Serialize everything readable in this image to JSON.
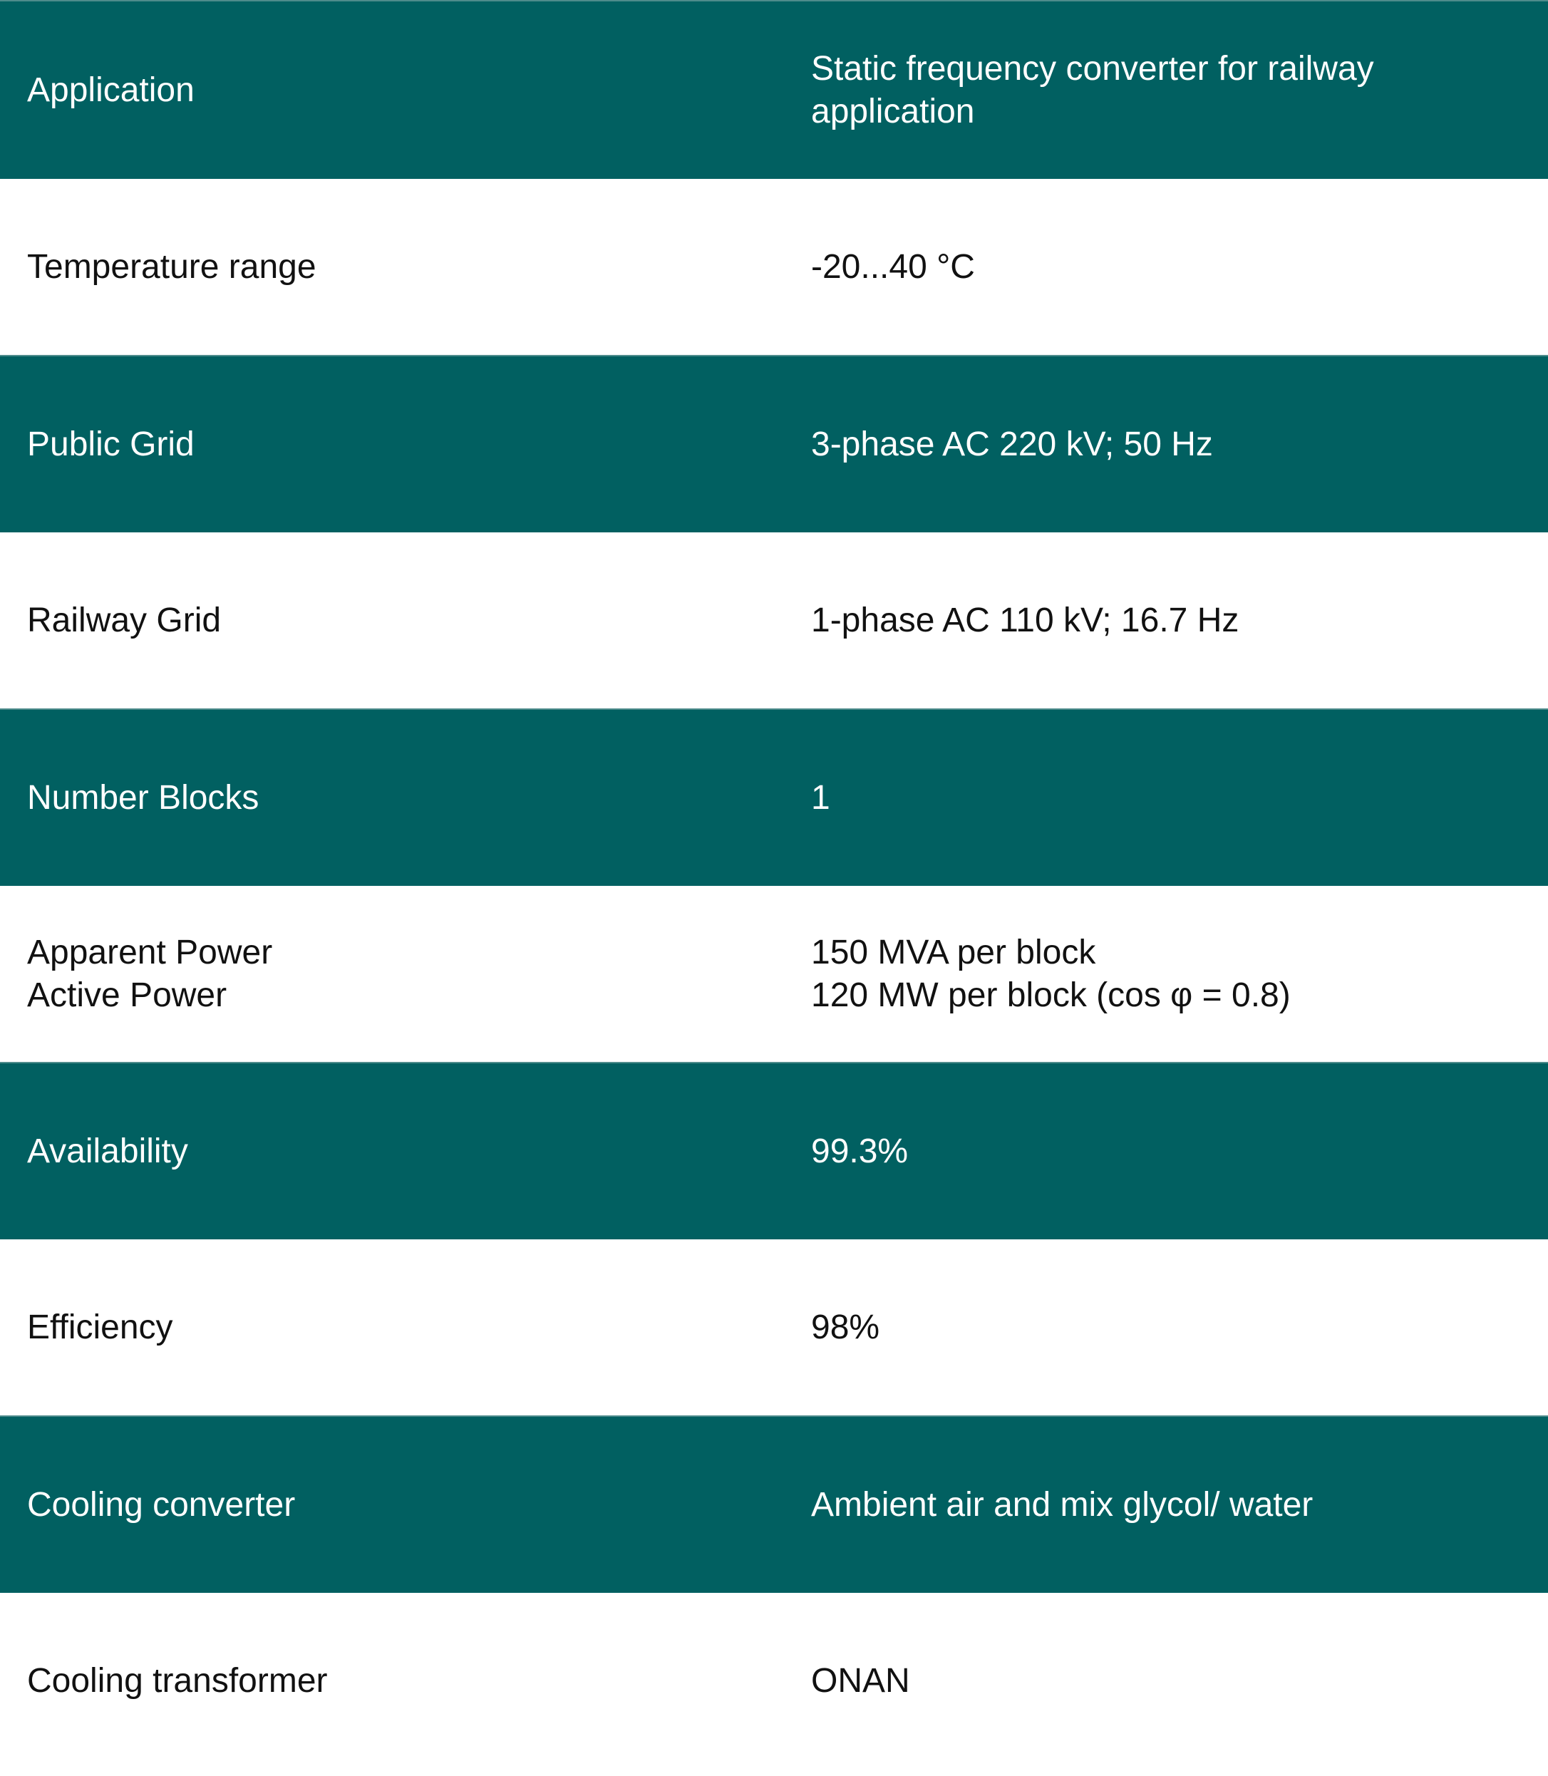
{
  "colors": {
    "row_dark": "#016061",
    "row_light": "#ffffff",
    "text_on_dark": "#ffffff",
    "text_on_light": "#111111"
  },
  "rows": [
    {
      "label": [
        "Application"
      ],
      "value": [
        "Static frequency converter for railway application"
      ]
    },
    {
      "label": [
        "Temperature range"
      ],
      "value": [
        "-20...40 °C"
      ]
    },
    {
      "label": [
        "Public Grid"
      ],
      "value": [
        "3-phase AC 220 kV; 50 Hz"
      ]
    },
    {
      "label": [
        "Railway Grid"
      ],
      "value": [
        "1-phase AC 110 kV; 16.7 Hz"
      ]
    },
    {
      "label": [
        "Number Blocks"
      ],
      "value": [
        "1"
      ]
    },
    {
      "label": [
        "Apparent Power",
        "Active Power"
      ],
      "value": [
        "150 MVA per block",
        "120 MW per block (cos φ = 0.8)"
      ]
    },
    {
      "label": [
        "Availability"
      ],
      "value": [
        "99.3%"
      ]
    },
    {
      "label": [
        "Efficiency"
      ],
      "value": [
        "98%"
      ]
    },
    {
      "label": [
        "Cooling converter"
      ],
      "value": [
        "Ambient air and mix glycol/ water"
      ]
    },
    {
      "label": [
        "Cooling transformer"
      ],
      "value": [
        "ONAN"
      ]
    }
  ]
}
